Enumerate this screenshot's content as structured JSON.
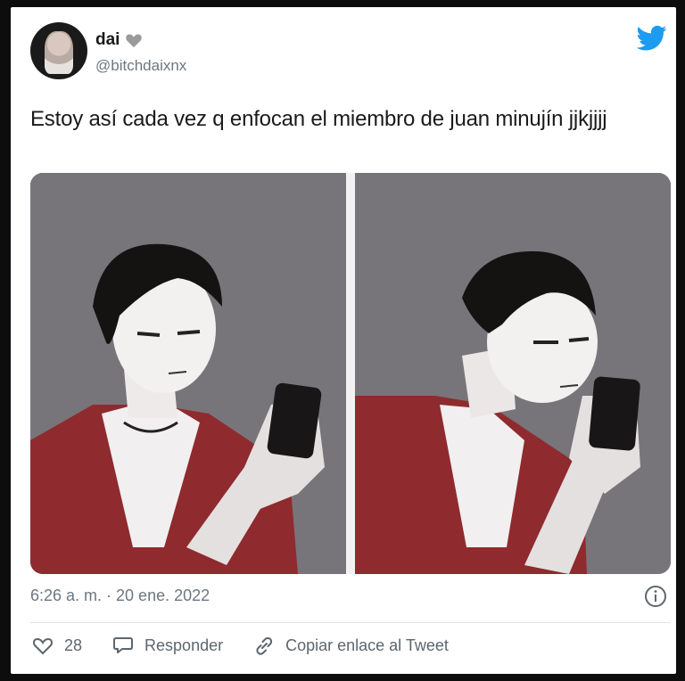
{
  "tweet": {
    "display_name": "dai",
    "username": "@bitchdaixnx",
    "text": "Estoy así cada vez q enfocan el miembro de juan minujín jjkjjjj",
    "timestamp": "6:26 a. m. · 20 ene. 2022"
  },
  "actions": {
    "likes_count": "28",
    "reply_label": "Responder",
    "copy_link_label": "Copiar enlace al Tweet"
  },
  "icons": {
    "heart_badge": "heart-icon",
    "brand": "twitter-bird-icon",
    "info": "info-icon",
    "like": "heart-outline-icon",
    "reply": "reply-bubble-icon",
    "copy_link": "link-icon"
  },
  "colors": {
    "background": "#0d0d0d",
    "card": "#ffffff",
    "twitter_blue": "#1d9bf0",
    "text_primary": "#1a1a1a",
    "text_secondary": "#6b7780",
    "jacket_red": "#8f2a2e"
  }
}
